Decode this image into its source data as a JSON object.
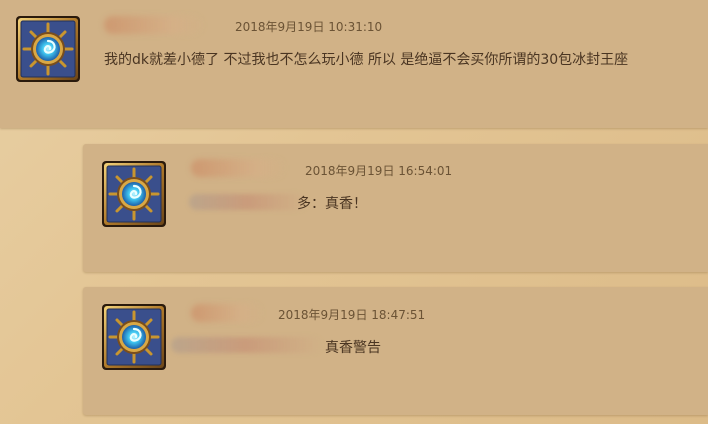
{
  "posts": [
    {
      "timestamp": "2018年9月19日 10:31:10",
      "content": "我的dk就差小德了 不过我也不怎么玩小德 所以 是绝逼不会买你所谓的30包冰封王座"
    },
    {
      "timestamp": "2018年9月19日 16:54:01",
      "content": "多：真香！"
    },
    {
      "timestamp": "2018年9月19日 18:47:51",
      "content": "真香警告"
    }
  ],
  "avatar_icon": "hearthstone-logo-icon",
  "colors": {
    "post_background": "#d1b287",
    "page_background": "#e3c594",
    "text": "#4a3522",
    "timestamp": "#6b5335"
  }
}
